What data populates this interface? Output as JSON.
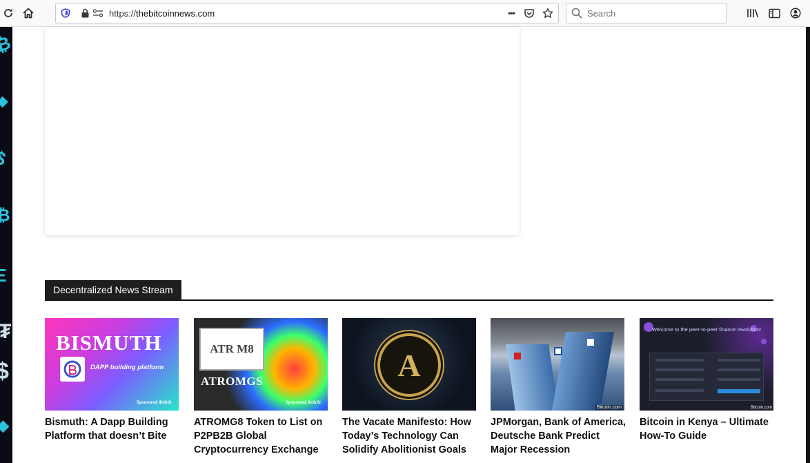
{
  "browser": {
    "url_scheme": "https://",
    "url_host": "thebitcoinnews.com",
    "search_placeholder": "Search",
    "more_icon_label": "•••"
  },
  "section": {
    "title": "Decentralized News Stream"
  },
  "articles": [
    {
      "title": "Bismuth: A Dapp Building Platform that doesn’t Bite",
      "thumb_heading": "BISMUTH",
      "thumb_tagline": "DAPP building platform",
      "thumb_badge": "Sponsored Article"
    },
    {
      "title": "ATROMG8 Token to List on P2PB2B Global Cryptocurrency Exchange",
      "thumb_logo": "ATR M8",
      "thumb_heading": "ATROMGS",
      "thumb_badge": "Sponsored Article"
    },
    {
      "title": "The Vacate Manifesto: How Today’s Technology Can Solidify Abolitionist Goals",
      "thumb_letter": "A"
    },
    {
      "title": "JPMorgan, Bank of America, Deutsche Bank Predict Major Recession",
      "thumb_credit": "Bitcoin.com"
    },
    {
      "title": "Bitcoin in Kenya – Ultimate How-To Guide",
      "thumb_heading": "Welcome to the peer-to-peer finance revolution!",
      "thumb_credit": "Bitcoin.com"
    }
  ],
  "colors": {
    "accent_dark": "#1e1e1e",
    "side_glyph": "#2fd6f2"
  }
}
